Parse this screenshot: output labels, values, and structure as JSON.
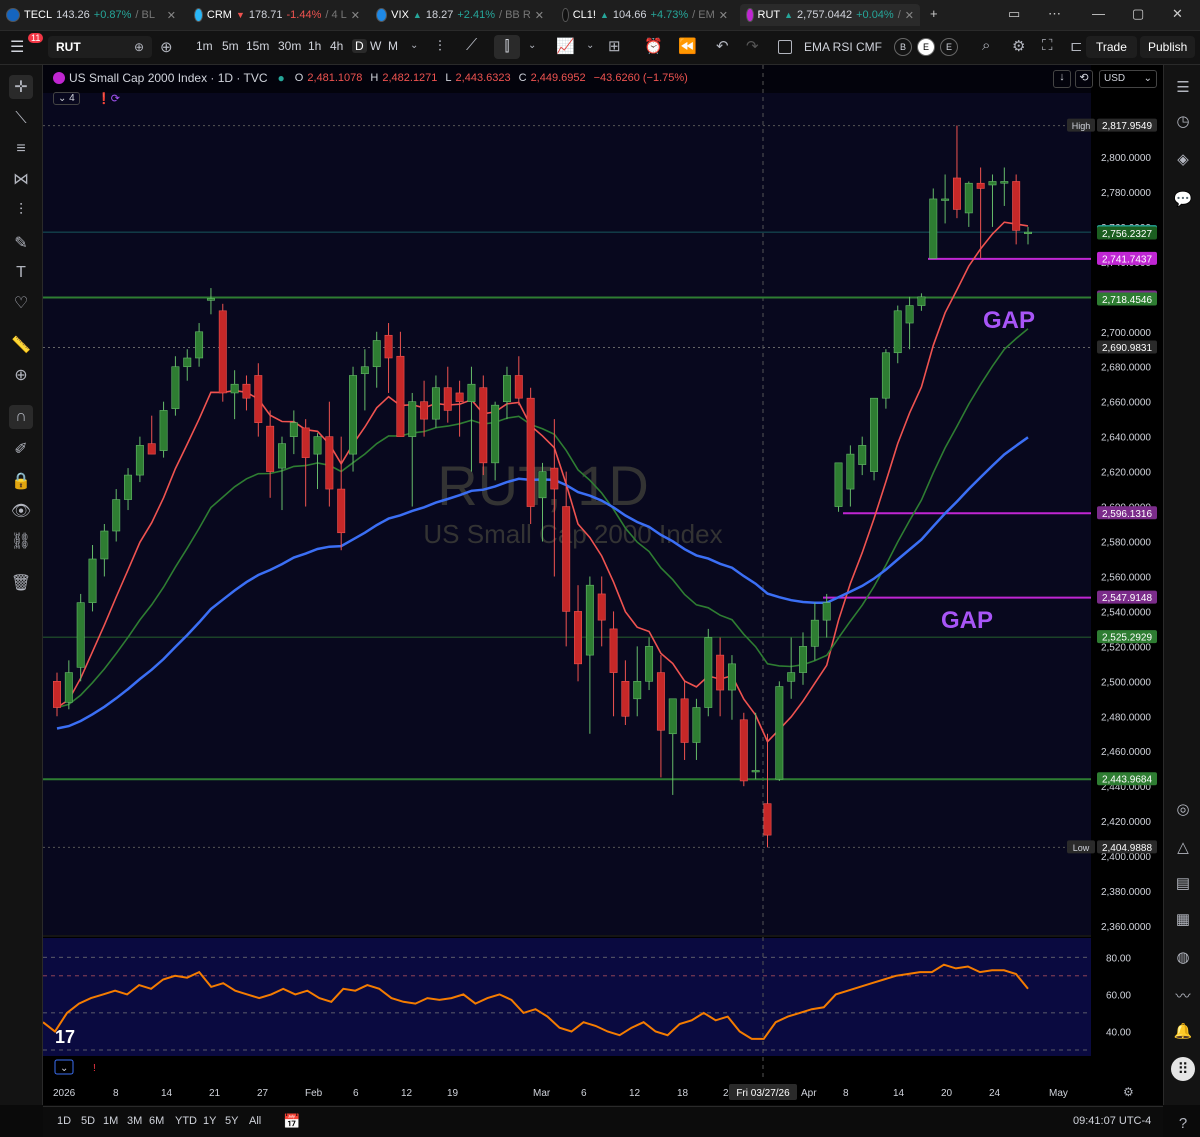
{
  "tabs": [
    {
      "symbol": "TECL",
      "price": "143.26",
      "change": "+0.87%",
      "rest": "/ BL",
      "dir": "up"
    },
    {
      "symbol": "CRM",
      "price": "178.71",
      "change": "-1.44%",
      "rest": "/ 4 L",
      "dir": "down",
      "arrow": "▼"
    },
    {
      "symbol": "VIX",
      "price": "18.27",
      "change": "+2.41%",
      "rest": "/ BB R",
      "dir": "up",
      "arrow": "▲"
    },
    {
      "symbol": "CL1!",
      "price": "104.66",
      "change": "+4.73%",
      "rest": "/ EM",
      "dir": "up",
      "arrow": "▲"
    },
    {
      "symbol": "RUT",
      "price": "2,757.0442",
      "change": "+0.04%",
      "rest": "/",
      "dir": "up",
      "arrow": "▲"
    }
  ],
  "toolbar": {
    "notif_count": "11",
    "symbol": "RUT",
    "intervals": [
      "1m",
      "5m",
      "15m",
      "30m",
      "1h",
      "4h",
      "D",
      "W",
      "M"
    ],
    "indicators_label": "EMA RSI CMF",
    "circle_labels": [
      "B",
      "E",
      "E"
    ],
    "trade_label": "Trade",
    "publish_label": "Publish"
  },
  "legend": {
    "title": "US Small Cap 2000 Index · 1D · TVC",
    "o_label": "O",
    "o": "2,481.1078",
    "h_label": "H",
    "h": "2,482.1271",
    "l_label": "L",
    "l": "2,443.6323",
    "c_label": "C",
    "c": "2,449.6952",
    "chg": "−43.6260 (−1.75%)",
    "collapse_count": "4",
    "currency": "USD"
  },
  "watermark": {
    "symbol": "RUT, 1D",
    "name": "US Small Cap 2000 Index"
  },
  "annotations": {
    "gap1": "GAP",
    "gap2": "GAP"
  },
  "price_labels": [
    {
      "text": "2,817.9549",
      "prefix": "High",
      "color": "#2a2a2a"
    },
    {
      "text": "2,757.0442",
      "color": "#26a69a"
    },
    {
      "text": "2,756.2327",
      "color": "#1b5e20"
    },
    {
      "text": "2,741.7437",
      "color": "#c026d3"
    },
    {
      "text": "2,719.6016",
      "color": "#7b2c8a"
    },
    {
      "text": "2,718.4546",
      "color": "#2e7d32"
    },
    {
      "text": "2,690.9831",
      "color": "#2a2a2a"
    },
    {
      "text": "2,596.1316",
      "color": "#7b2c8a"
    },
    {
      "text": "2,547.9148",
      "color": "#7b2c8a"
    },
    {
      "text": "2,525.2929",
      "color": "#2e7d32"
    },
    {
      "text": "2,443.9684",
      "color": "#2e7d32"
    },
    {
      "text": "2,404.9888",
      "prefix": "Low",
      "color": "#2a2a2a"
    }
  ],
  "price_axis": [
    "2,800.0000",
    "2,780.0000",
    "2,760.0000",
    "2,740.0000",
    "2,720.0000",
    "2,700.0000",
    "2,680.0000",
    "2,660.0000",
    "2,640.0000",
    "2,620.0000",
    "2,600.0000",
    "2,580.0000",
    "2,560.0000",
    "2,540.0000",
    "2,520.0000",
    "2,500.0000",
    "2,480.0000",
    "2,460.0000",
    "2,440.0000",
    "2,420.0000",
    "2,400.0000",
    "2,380.0000",
    "2,360.0000"
  ],
  "rsi_axis": [
    "80.00",
    "60.00",
    "40.00"
  ],
  "time_axis": [
    "2026",
    "8",
    "14",
    "21",
    "27",
    "Feb",
    "6",
    "12",
    "19",
    "Mar",
    "6",
    "12",
    "18",
    "24",
    "Apr",
    "8",
    "14",
    "20",
    "24",
    "May"
  ],
  "crosshair_date": "Fri 03/27/26",
  "ranges": [
    "1D",
    "5D",
    "1M",
    "3M",
    "6M",
    "YTD",
    "1Y",
    "5Y",
    "All"
  ],
  "clock": "09:41:07 UTC-4",
  "chart_data": {
    "type": "candlestick",
    "ylim": [
      2355,
      2830
    ],
    "candles": [
      [
        2500,
        2505,
        2480,
        2485
      ],
      [
        2488,
        2512,
        2484,
        2505
      ],
      [
        2508,
        2550,
        2500,
        2545
      ],
      [
        2545,
        2578,
        2540,
        2570
      ],
      [
        2570,
        2590,
        2560,
        2586
      ],
      [
        2586,
        2610,
        2580,
        2604
      ],
      [
        2604,
        2622,
        2598,
        2618
      ],
      [
        2618,
        2640,
        2614,
        2635
      ],
      [
        2636,
        2652,
        2630,
        2630
      ],
      [
        2632,
        2660,
        2628,
        2655
      ],
      [
        2656,
        2686,
        2652,
        2680
      ],
      [
        2680,
        2690,
        2672,
        2685
      ],
      [
        2685,
        2705,
        2680,
        2700
      ],
      [
        2718,
        2725,
        2710,
        2719
      ],
      [
        2712,
        2716,
        2660,
        2665
      ],
      [
        2665,
        2678,
        2650,
        2670
      ],
      [
        2670,
        2675,
        2655,
        2662
      ],
      [
        2675,
        2682,
        2640,
        2648
      ],
      [
        2646,
        2655,
        2605,
        2620
      ],
      [
        2622,
        2640,
        2598,
        2636
      ],
      [
        2640,
        2655,
        2630,
        2648
      ],
      [
        2645,
        2650,
        2600,
        2628
      ],
      [
        2630,
        2642,
        2610,
        2640
      ],
      [
        2640,
        2660,
        2600,
        2610
      ],
      [
        2610,
        2640,
        2575,
        2585
      ],
      [
        2630,
        2680,
        2620,
        2675
      ],
      [
        2676,
        2690,
        2655,
        2680
      ],
      [
        2680,
        2700,
        2668,
        2695
      ],
      [
        2698,
        2705,
        2665,
        2685
      ],
      [
        2686,
        2700,
        2640,
        2640
      ],
      [
        2640,
        2665,
        2600,
        2660
      ],
      [
        2660,
        2672,
        2640,
        2650
      ],
      [
        2650,
        2675,
        2645,
        2668
      ],
      [
        2668,
        2680,
        2648,
        2655
      ],
      [
        2665,
        2672,
        2640,
        2660
      ],
      [
        2660,
        2680,
        2620,
        2670
      ],
      [
        2668,
        2675,
        2618,
        2625
      ],
      [
        2625,
        2660,
        2615,
        2658
      ],
      [
        2660,
        2680,
        2650,
        2675
      ],
      [
        2675,
        2686,
        2658,
        2662
      ],
      [
        2662,
        2668,
        2590,
        2600
      ],
      [
        2605,
        2625,
        2580,
        2620
      ],
      [
        2622,
        2650,
        2560,
        2610
      ],
      [
        2600,
        2620,
        2520,
        2540
      ],
      [
        2540,
        2555,
        2500,
        2510
      ],
      [
        2515,
        2560,
        2470,
        2555
      ],
      [
        2550,
        2560,
        2520,
        2535
      ],
      [
        2530,
        2540,
        2480,
        2505
      ],
      [
        2500,
        2512,
        2475,
        2480
      ],
      [
        2490,
        2520,
        2480,
        2500
      ],
      [
        2500,
        2525,
        2495,
        2520
      ],
      [
        2505,
        2515,
        2445,
        2472
      ],
      [
        2470,
        2490,
        2435,
        2490
      ],
      [
        2490,
        2500,
        2455,
        2465
      ],
      [
        2465,
        2490,
        2455,
        2485
      ],
      [
        2485,
        2530,
        2480,
        2525
      ],
      [
        2515,
        2525,
        2480,
        2495
      ],
      [
        2495,
        2515,
        2478,
        2510
      ],
      [
        2478,
        2482,
        2440,
        2443
      ],
      [
        2449,
        2482,
        2444,
        2449
      ],
      [
        2430,
        2470,
        2405,
        2412
      ],
      [
        2444,
        2500,
        2443,
        2497
      ],
      [
        2500,
        2525,
        2490,
        2505
      ],
      [
        2505,
        2528,
        2498,
        2520
      ],
      [
        2520,
        2545,
        2512,
        2535
      ],
      [
        2535,
        2550,
        2525,
        2545
      ],
      [
        2600,
        2625,
        2597,
        2625
      ],
      [
        2610,
        2635,
        2600,
        2630
      ],
      [
        2624,
        2640,
        2618,
        2635
      ],
      [
        2620,
        2660,
        2615,
        2662
      ],
      [
        2662,
        2690,
        2656,
        2688
      ],
      [
        2688,
        2715,
        2682,
        2712
      ],
      [
        2705,
        2720,
        2690,
        2715
      ],
      [
        2715,
        2722,
        2712,
        2720
      ],
      [
        2742,
        2782,
        2742,
        2776
      ],
      [
        2776,
        2790,
        2762,
        2776
      ],
      [
        2788,
        2818,
        2765,
        2770
      ],
      [
        2768,
        2786,
        2760,
        2785
      ],
      [
        2785,
        2794,
        2742,
        2782
      ],
      [
        2784,
        2790,
        2760,
        2786
      ],
      [
        2785,
        2794,
        2772,
        2786
      ],
      [
        2786,
        2790,
        2750,
        2758
      ],
      [
        2757,
        2760,
        2750,
        2757
      ]
    ],
    "rsi": [
      45,
      40,
      50,
      55,
      58,
      60,
      62,
      60,
      65,
      63,
      68,
      70,
      69,
      72,
      64,
      66,
      62,
      60,
      58,
      60,
      63,
      60,
      62,
      58,
      56,
      63,
      62,
      65,
      63,
      58,
      56,
      55,
      58,
      57,
      58,
      60,
      55,
      58,
      60,
      57,
      50,
      52,
      48,
      42,
      40,
      45,
      43,
      40,
      38,
      42,
      45,
      40,
      38,
      44,
      46,
      50,
      46,
      48,
      40,
      36,
      36,
      45,
      48,
      50,
      52,
      53,
      60,
      62,
      64,
      66,
      68,
      70,
      71,
      72,
      72,
      76,
      74,
      75,
      72,
      73,
      73,
      71,
      63
    ]
  }
}
